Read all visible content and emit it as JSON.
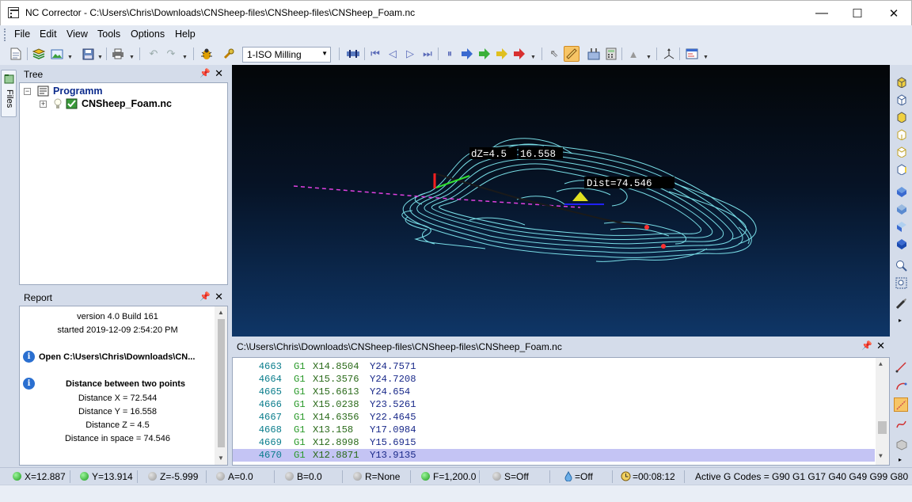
{
  "window": {
    "title": "NC Corrector - C:\\Users\\Chris\\Downloads\\CNSheep-files\\CNSheep-files\\CNSheep_Foam.nc",
    "minimize": "—",
    "maximize": "☐",
    "close": "✕"
  },
  "menu": [
    "File",
    "Edit",
    "View",
    "Tools",
    "Options",
    "Help"
  ],
  "toolbar": {
    "operation": "1-ISO Milling"
  },
  "sidetab": {
    "files": "Files"
  },
  "tree": {
    "title": "Tree",
    "root": "Programm",
    "file": "CNSheep_Foam.nc"
  },
  "report": {
    "title": "Report",
    "version": "version 4.0 Build 161",
    "started": "started 2019-12-09 2:54:20 PM",
    "open": "Open C:\\Users\\Chris\\Downloads\\CN...",
    "dist_title": "Distance between two points",
    "dx": "Distance X = 72.544",
    "dy": "Distance Y = 16.558",
    "dz": "Distance Z = 4.5",
    "ds": "Distance in space = 74.546"
  },
  "viewport": {
    "label_dz": "dZ=4.5",
    "label_dy": "16.558",
    "label_dist": "Dist=74.546"
  },
  "code": {
    "path": "C:\\Users\\Chris\\Downloads\\CNSheep-files\\CNSheep-files\\CNSheep_Foam.nc",
    "rows": [
      {
        "n": "4663",
        "g": "G1",
        "x": "X14.8504",
        "y": "Y24.7571"
      },
      {
        "n": "4664",
        "g": "G1",
        "x": "X15.3576",
        "y": "Y24.7208"
      },
      {
        "n": "4665",
        "g": "G1",
        "x": "X15.6613",
        "y": "Y24.654"
      },
      {
        "n": "4666",
        "g": "G1",
        "x": "X15.0238",
        "y": "Y23.5261"
      },
      {
        "n": "4667",
        "g": "G1",
        "x": "X14.6356",
        "y": "Y22.4645"
      },
      {
        "n": "4668",
        "g": "G1",
        "x": "X13.158",
        "y": "Y17.0984"
      },
      {
        "n": "4669",
        "g": "G1",
        "x": "X12.8998",
        "y": "Y15.6915"
      },
      {
        "n": "4670",
        "g": "G1",
        "x": "X12.8871",
        "y": "Y13.9135"
      }
    ],
    "selected_row": 7
  },
  "status": {
    "x": "X=12.887",
    "y": "Y=13.914",
    "z": "Z=-5.999",
    "a": "A=0.0",
    "b": "B=0.0",
    "r": "R=None",
    "f": "F=1,200.0",
    "s": "S=Off",
    "coolant": "=Off",
    "time": "=00:08:12",
    "gcodes": "Active G Codes = G90 G1 G17 G40 G49 G99 G80"
  },
  "colors": {
    "toolpath": "#7fe8f0",
    "viewport_top": "#040608",
    "viewport_bottom": "#0f3667",
    "selection": "#c4c4f4"
  }
}
